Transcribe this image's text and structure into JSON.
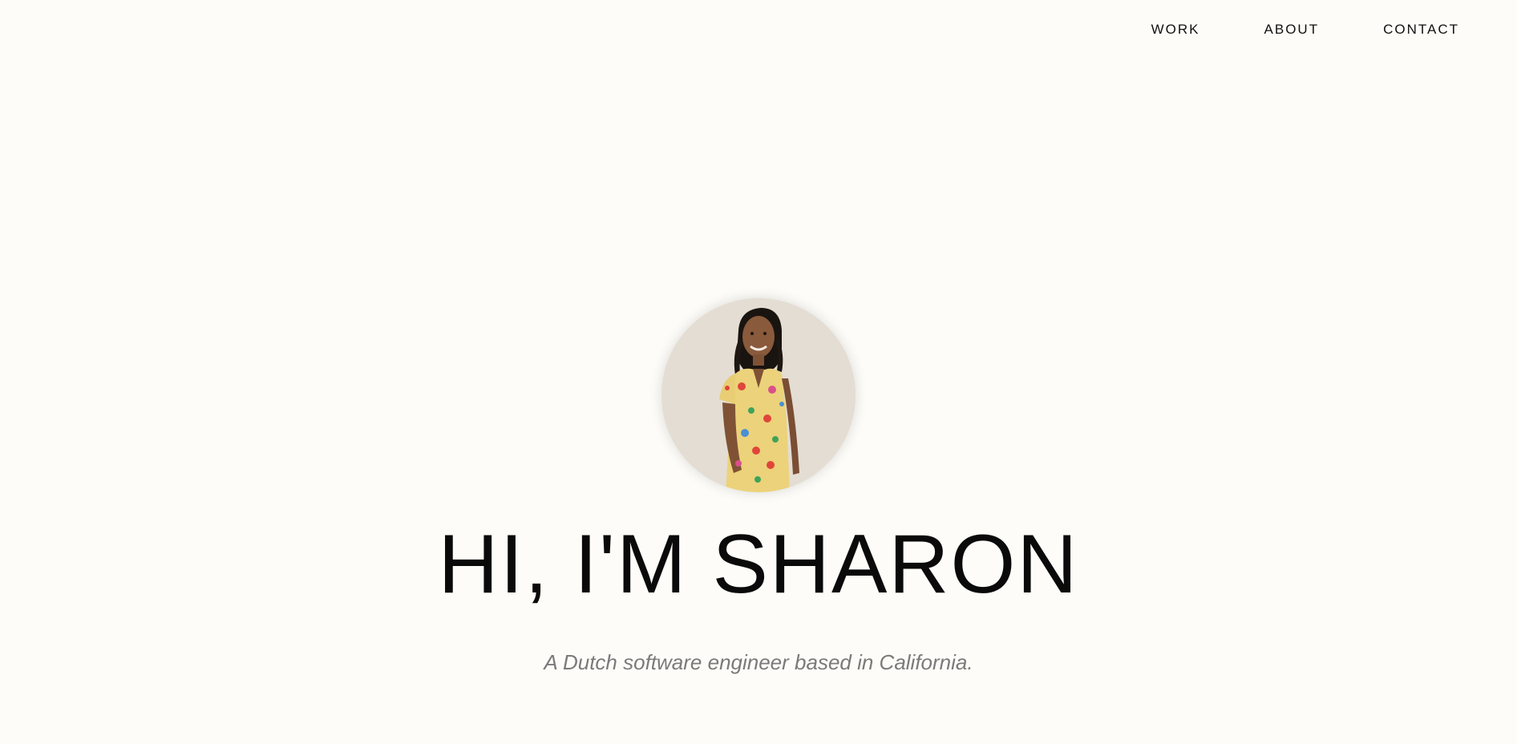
{
  "nav": {
    "items": [
      {
        "label": "WORK"
      },
      {
        "label": "ABOUT"
      },
      {
        "label": "CONTACT"
      }
    ]
  },
  "hero": {
    "avatar_icon": "portrait-photo",
    "title": "HI, I'M SHARON",
    "subtitle": "A Dutch software engineer based in California."
  },
  "colors": {
    "background": "#fdfcf8",
    "title": "#0a0a0a",
    "subtitle": "#7a7a7a",
    "avatar_bg": "#e4ddd3"
  }
}
